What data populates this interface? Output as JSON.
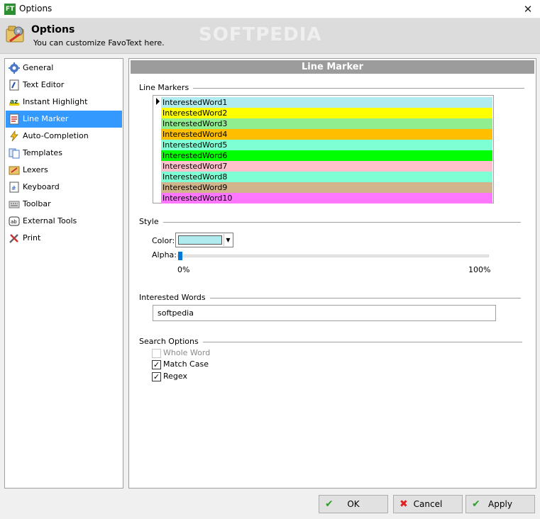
{
  "window": {
    "app_icon_text": "FT",
    "title": "Options",
    "close_glyph": "✕"
  },
  "header": {
    "title": "Options",
    "subtitle": "You can customize FavoText here.",
    "watermark": "SOFTPEDIA"
  },
  "nav": {
    "items": [
      {
        "label": "General",
        "icon": "gear-icon"
      },
      {
        "label": "Text Editor",
        "icon": "text-editor-icon"
      },
      {
        "label": "Instant Highlight",
        "icon": "highlight-icon"
      },
      {
        "label": "Line Marker",
        "icon": "line-marker-icon",
        "active": true
      },
      {
        "label": "Auto-Completion",
        "icon": "lightning-icon"
      },
      {
        "label": "Templates",
        "icon": "templates-icon"
      },
      {
        "label": "Lexers",
        "icon": "lexers-icon"
      },
      {
        "label": "Keyboard",
        "icon": "keyboard-icon"
      },
      {
        "label": "Toolbar",
        "icon": "toolbar-icon"
      },
      {
        "label": "External Tools",
        "icon": "external-tools-icon"
      },
      {
        "label": "Print",
        "icon": "print-icon"
      }
    ]
  },
  "panel": {
    "title": "Line Marker",
    "line_markers": {
      "group_label": "Line Markers",
      "items": [
        {
          "label": "InterestedWord1",
          "color": "#b0ecef"
        },
        {
          "label": "InterestedWord2",
          "color": "#ffff00"
        },
        {
          "label": "InterestedWord3",
          "color": "#90ee90"
        },
        {
          "label": "InterestedWord4",
          "color": "#ffbf00"
        },
        {
          "label": "InterestedWord5",
          "color": "#7fffd4"
        },
        {
          "label": "InterestedWord6",
          "color": "#00ff00"
        },
        {
          "label": "InterestedWord7",
          "color": "#ffc0cb"
        },
        {
          "label": "InterestedWord8",
          "color": "#7fffd4"
        },
        {
          "label": "InterestedWord9",
          "color": "#d2b48c"
        },
        {
          "label": "InterestedWord10",
          "color": "#ff77ff"
        }
      ]
    },
    "style": {
      "group_label": "Style",
      "color_label": "Color:",
      "selected_color": "#b0ecef",
      "alpha_label": "Alpha:",
      "alpha_value": 0,
      "alpha_min": "0%",
      "alpha_max": "100%"
    },
    "interested_words": {
      "group_label": "Interested Words",
      "value": "softpedia"
    },
    "search_options": {
      "group_label": "Search Options",
      "whole_word": {
        "label": "Whole Word",
        "checked": false,
        "disabled": true
      },
      "match_case": {
        "label": "Match Case",
        "checked": true
      },
      "regex": {
        "label": "Regex",
        "checked": true
      }
    }
  },
  "buttons": {
    "ok": "OK",
    "cancel": "Cancel",
    "apply": "Apply"
  }
}
